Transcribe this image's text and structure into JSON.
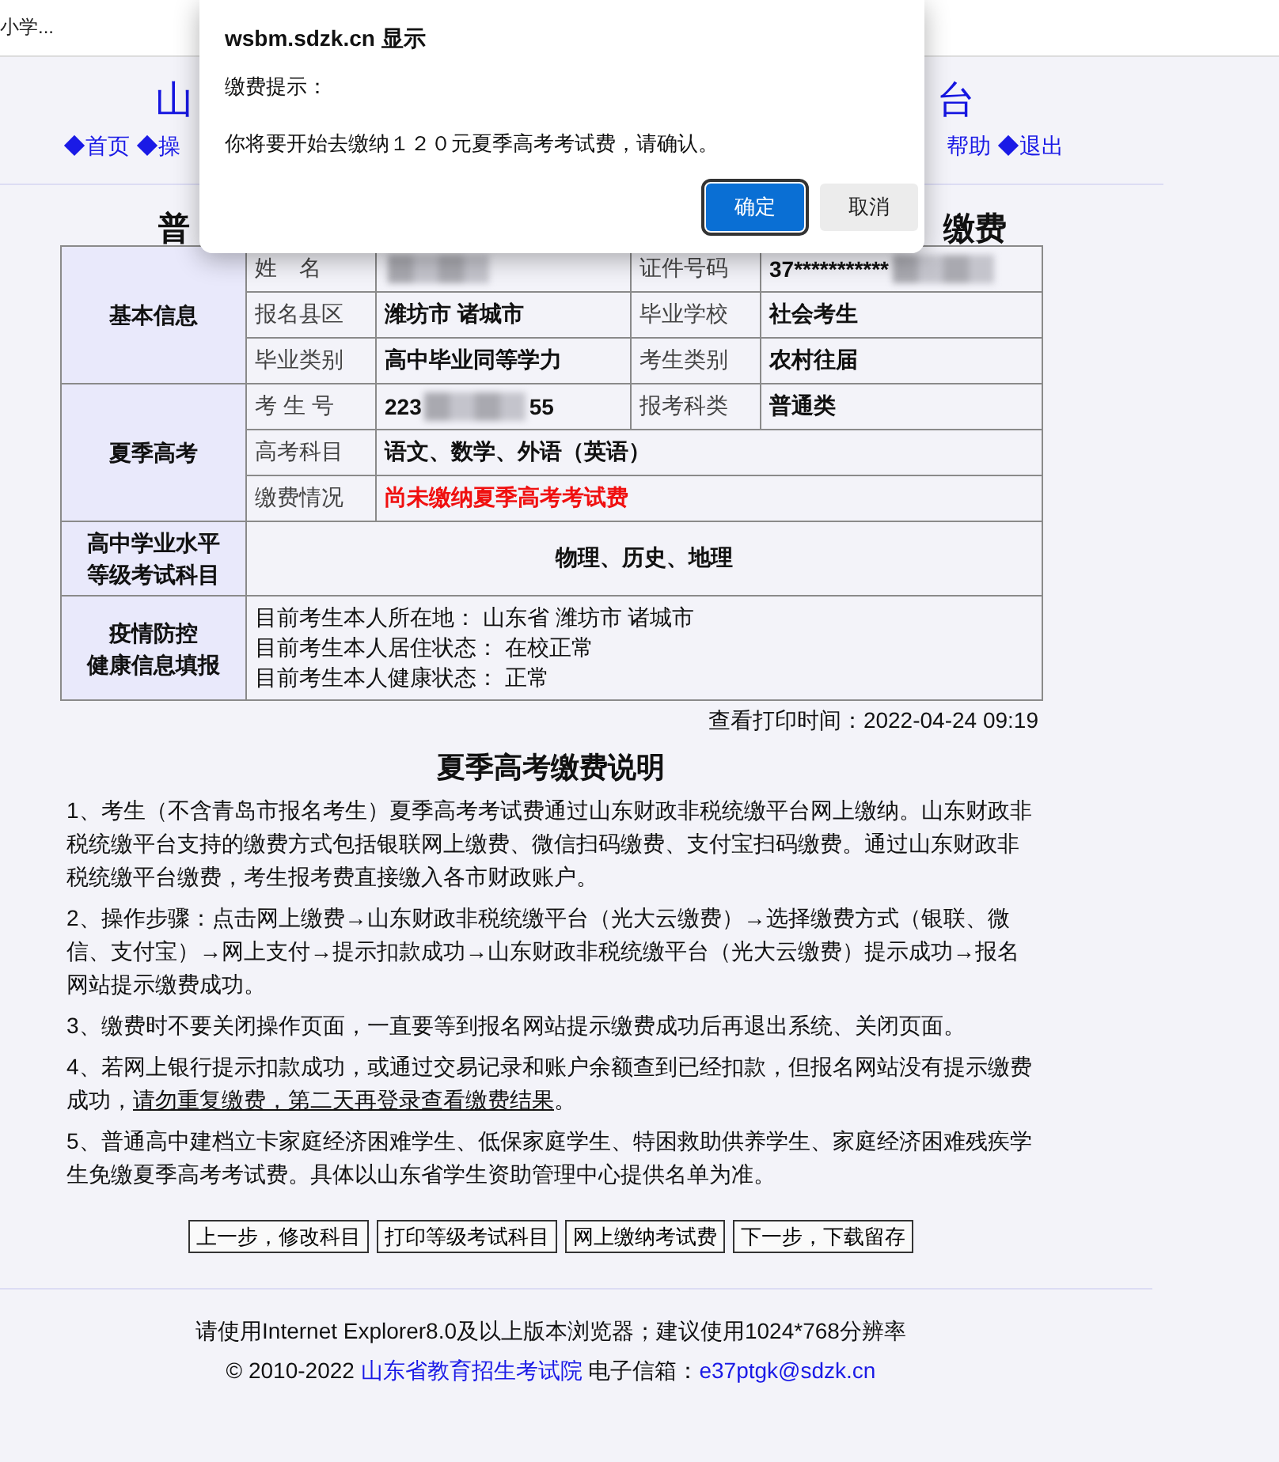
{
  "browser_tab": {
    "title": "小学..."
  },
  "header": {
    "title_left": "山",
    "title_right": "台",
    "nav_left": "◆首页 ◆操",
    "nav_right": [
      "帮助",
      "◆退出"
    ]
  },
  "page_title": {
    "left": "普",
    "right": "缴费"
  },
  "info_table": {
    "sections": [
      {
        "kind": "fields",
        "heading": [
          "基本信息"
        ],
        "rows": [
          [
            {
              "label": "姓　名",
              "redacted": true
            },
            {
              "label": "证件号码",
              "value": "37***********",
              "redacted": true
            }
          ],
          [
            {
              "label": "报名县区",
              "value": "潍坊市 诸城市"
            },
            {
              "label": "毕业学校",
              "value": "社会考生"
            }
          ],
          [
            {
              "label": "毕业类别",
              "value": "高中毕业同等学力"
            },
            {
              "label": "考生类别",
              "value": "农村往届"
            }
          ]
        ]
      },
      {
        "kind": "fields",
        "heading": [
          "夏季高考"
        ],
        "rows": [
          [
            {
              "label": "考 生 号",
              "value": "223",
              "tail": "55",
              "redacted": true
            },
            {
              "label": "报考科类",
              "value": "普通类"
            }
          ],
          [
            {
              "label": "高考科目",
              "value": "语文、数学、外语（英语）"
            }
          ],
          [
            {
              "label": "缴费情况",
              "value": "尚未缴纳夏季高考考试费",
              "alert": true
            }
          ]
        ]
      },
      {
        "kind": "subjects",
        "heading": [
          "高中学业水平",
          "等级考试科目"
        ],
        "text": "物理、历史、地理"
      },
      {
        "kind": "lines",
        "heading": [
          "疫情防控",
          "健康信息填报"
        ],
        "lines": [
          "目前考生本人所在地：  山东省 潍坊市 诸城市",
          "目前考生本人居住状态：  在校正常",
          "目前考生本人健康状态：  正常"
        ]
      }
    ]
  },
  "print_time": "查看打印时间：2022-04-24 09:19",
  "notes": {
    "title": "夏季高考缴费说明",
    "paragraphs": [
      [
        {
          "text": "1、考生（不含青岛市报名考生）夏季高考考试费通过山东财政非税统缴平台网上缴纳。山东财政非税统缴平台支持的缴费方式包括银联网上缴费、微信扫码缴费、支付宝扫码缴费。通过山东财政非税统缴平台缴费，考生报考费直接缴入各市财政账户。",
          "underlined": false
        }
      ],
      [
        {
          "text": "2、操作步骤：点击网上缴费→山东财政非税统缴平台（光大云缴费）→选择缴费方式（银联、微信、支付宝）→网上支付→提示扣款成功→山东财政非税统缴平台（光大云缴费）提示成功→报名网站提示缴费成功。",
          "underlined": false
        }
      ],
      [
        {
          "text": "3、缴费时不要关闭操作页面，一直要等到报名网站提示缴费成功后再退出系统、关闭页面。",
          "underlined": false
        }
      ],
      [
        {
          "text": "4、若网上银行提示扣款成功，或通过交易记录和账户余额查到已经扣款，但报名网站没有提示缴费成功，",
          "underlined": false
        },
        {
          "text": "请勿重复缴费，第二天再登录查看缴费结果",
          "underlined": true
        },
        {
          "text": "。",
          "underlined": false
        }
      ],
      [
        {
          "text": "5、普通高中建档立卡家庭经济困难学生、低保家庭学生、特困救助供养学生、家庭经济困难残疾学生免缴夏季高考考试费。具体以山东省学生资助管理中心提供名单为准。",
          "underlined": false
        }
      ]
    ]
  },
  "buttons": [
    "上一步，修改科目",
    "打印等级考试科目",
    "网上缴纳考试费",
    "下一步，下载留存"
  ],
  "footer": {
    "notice": "请使用Internet Explorer8.0及以上版本浏览器；建议使用1024*768分辨率",
    "copyright": "© 2010-2022 ",
    "org_link": "山东省教育招生考试院",
    "email_label": " 电子信箱：",
    "email_link": "e37ptgk@sdzk.cn"
  },
  "dialog": {
    "title": "wsbm.sdzk.cn 显示",
    "label": "缴费提示：",
    "message": "你将要开始去缴纳１２０元夏季高考考试费，请确认。",
    "buttons": [
      {
        "label": "确定",
        "kind": "primary"
      },
      {
        "label": "取消",
        "kind": "secondary"
      }
    ]
  }
}
